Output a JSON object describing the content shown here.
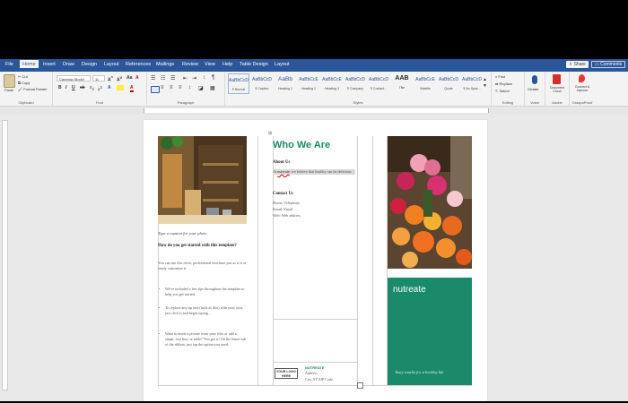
{
  "tabs": [
    "File",
    "Home",
    "Insert",
    "Draw",
    "Design",
    "Layout",
    "References",
    "Mailings",
    "Review",
    "View",
    "Help",
    "Table Design",
    "Layout"
  ],
  "active_tab": "Home",
  "share": "Share",
  "comments": "Comments",
  "clipboard": {
    "paste": "Paste",
    "cut": "Cut",
    "copy": "Copy",
    "format_painter": "Format Painter",
    "label": "Clipboard"
  },
  "font": {
    "name": "Cambria (Body)",
    "size": "11",
    "label": "Font"
  },
  "paragraph": {
    "label": "Paragraph"
  },
  "styles": {
    "label": "Styles",
    "items": [
      {
        "sample": "AaBbCcD",
        "name": "¶ Normal"
      },
      {
        "sample": "AaBbCcD",
        "name": "¶ Caption"
      },
      {
        "sample": "AaBb",
        "name": "Heading 1"
      },
      {
        "sample": "AaBbCcE",
        "name": "Heading 2"
      },
      {
        "sample": "AaBbCcE",
        "name": "Heading 3"
      },
      {
        "sample": "AaBbCcD",
        "name": "¶ Company"
      },
      {
        "sample": "AaBbCcD",
        "name": "¶ Contact..."
      },
      {
        "sample": "AAB",
        "name": "Title"
      },
      {
        "sample": "AaBbCcE",
        "name": "Subtitle"
      },
      {
        "sample": "AaBbCcD",
        "name": "Quote"
      },
      {
        "sample": "AaBbCcD",
        "name": "¶ No Spac..."
      }
    ]
  },
  "editing": {
    "find": "Find",
    "replace": "Replace",
    "select": "Select",
    "label": "Editing"
  },
  "voice": {
    "dictate": "Dictate",
    "label": "Voice"
  },
  "adobe": {
    "doc_cloud": "Document Cloud",
    "label": "Adobe"
  },
  "grasp": {
    "connect": "Connect & Improve",
    "label": "GraspaProof"
  },
  "doc": {
    "caption": "Type a caption for your photo",
    "q_heading": "How do you get started with this template?",
    "q_body": "You can use this fresh, professional brochure just as it is or easily customize it.",
    "bullets": [
      "We've included a few tips throughout the template to help you get started.",
      "To replace any tip text (such as this) with your own, just click it and begin typing.",
      "Want to insert a picture from your files or add a shape, text box, or table? You got it! On the Insert tab of the ribbon, just tap the option you need."
    ],
    "who_title": "Who We Are",
    "about_head": "About Us",
    "about_body_1": "At",
    "about_body_name": "nutreate",
    "about_body_2": ", we believe that healthy can be delicious.",
    "contact_head": "Contact Us",
    "contact_lines": [
      "Phone: Telephone",
      "Email: Email",
      "Web: Web address"
    ],
    "logo": "YOUR LOGO HERE",
    "company": "NUTREATE",
    "address_lines": [
      "Address",
      "City, ST ZIP Code"
    ],
    "brand": "nutreate",
    "tagline": "Tasty snacks for a healthy life"
  },
  "colors": {
    "ribbon_blue": "#2b579a",
    "brand_green": "#1b8a6b"
  }
}
